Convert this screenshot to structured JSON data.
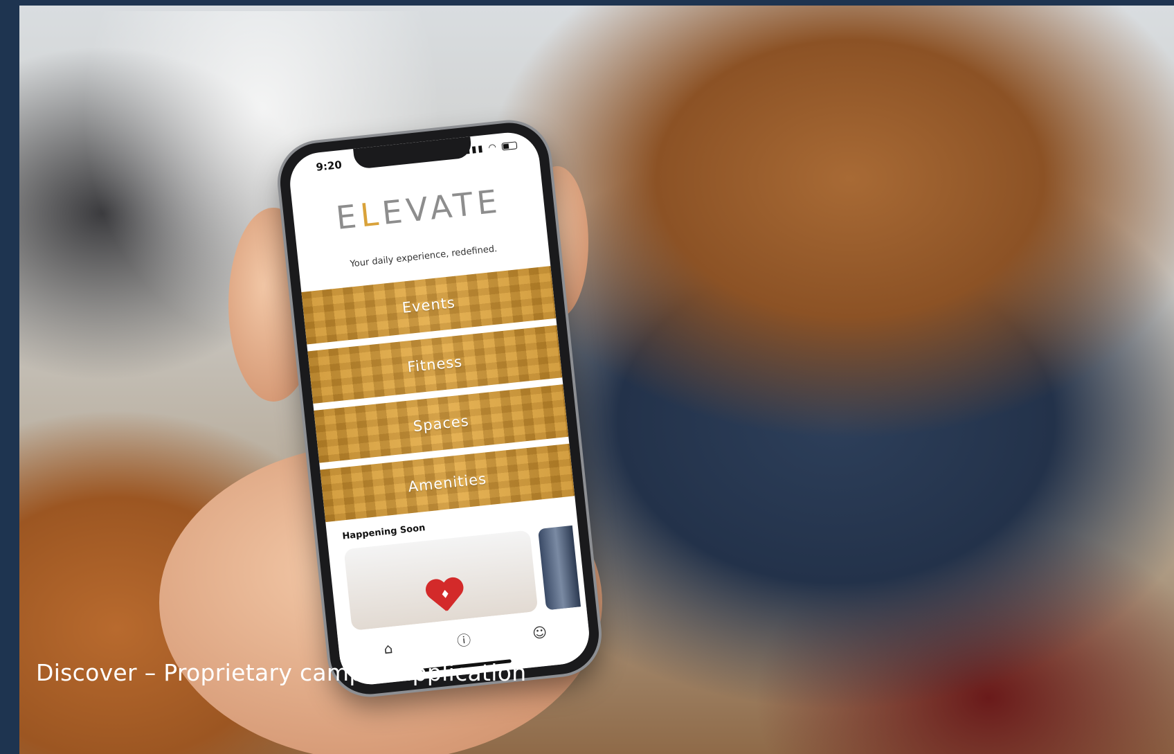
{
  "phone": {
    "status_time": "9:20",
    "logo_parts": [
      "E",
      "L",
      "EVATE"
    ],
    "tagline": "Your daily experience, redefined.",
    "tiles": [
      {
        "label": "Events"
      },
      {
        "label": "Fitness"
      },
      {
        "label": "Spaces"
      },
      {
        "label": "Amenities"
      }
    ],
    "section_title": "Happening Soon",
    "nav": [
      {
        "name": "home-icon"
      },
      {
        "name": "info-icon"
      },
      {
        "name": "profile-icon"
      }
    ]
  },
  "caption": "Discover – Proprietary campus application",
  "colors": {
    "border": "#1e3450",
    "brand_gold": "#d9a23a",
    "tile_gold": "#e0a845",
    "caption_text": "#ffffff"
  }
}
